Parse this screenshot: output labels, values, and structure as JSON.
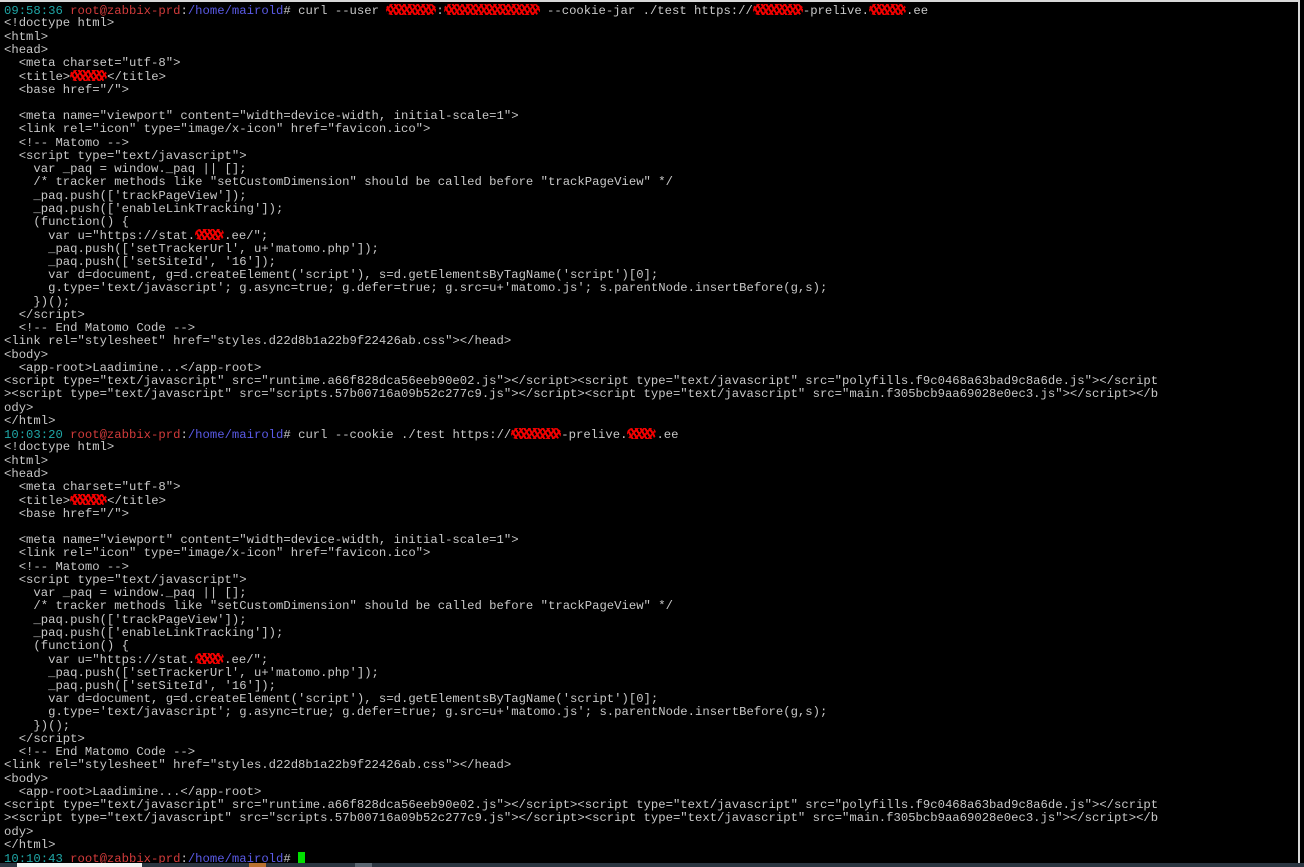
{
  "colors": {
    "time": "#1fa7a7",
    "user": "#d23b3b",
    "path": "#5a5ae6",
    "text": "#c8c8c8",
    "cursor": "#00e000",
    "redaction": "#ff0000"
  },
  "terminal": {
    "lines": [
      [
        {
          "c": "time",
          "t": "09:58:36 "
        },
        {
          "c": "user",
          "t": "root@zabbix-prd"
        },
        {
          "c": "sep",
          "t": ":"
        },
        {
          "c": "path",
          "t": "/home/mairold"
        },
        {
          "c": "sep",
          "t": "# curl --user "
        },
        {
          "redacted": "md"
        },
        {
          "t": ":"
        },
        {
          "redacted": "lg"
        },
        {
          "t": " --cookie-jar ./test https://"
        },
        {
          "redacted": "md"
        },
        {
          "t": "-prelive."
        },
        {
          "redacted": "sm"
        },
        {
          "t": ".ee"
        }
      ],
      "<!doctype html>",
      "<html>",
      "<head>",
      "  <meta charset=\"utf-8\">",
      [
        {
          "t": "  <title>"
        },
        {
          "redacted": "sm"
        },
        {
          "t": "</title>"
        }
      ],
      "  <base href=\"/\">",
      "",
      "  <meta name=\"viewport\" content=\"width=device-width, initial-scale=1\">",
      "  <link rel=\"icon\" type=\"image/x-icon\" href=\"favicon.ico\">",
      "  <!-- Matomo -->",
      "  <script type=\"text/javascript\">",
      "    var _paq = window._paq || [];",
      "    /* tracker methods like \"setCustomDimension\" should be called before \"trackPageView\" */",
      "    _paq.push(['trackPageView']);",
      "    _paq.push(['enableLinkTracking']);",
      "    (function() {",
      [
        {
          "t": "      var u=\"https://stat."
        },
        {
          "redacted": "xs"
        },
        {
          "t": ".ee/\";"
        }
      ],
      "      _paq.push(['setTrackerUrl', u+'matomo.php']);",
      "      _paq.push(['setSiteId', '16']);",
      "      var d=document, g=d.createElement('script'), s=d.getElementsByTagName('script')[0];",
      "      g.type='text/javascript'; g.async=true; g.defer=true; g.src=u+'matomo.js'; s.parentNode.insertBefore(g,s);",
      "    })();",
      "  </script>",
      "  <!-- End Matomo Code -->",
      "<link rel=\"stylesheet\" href=\"styles.d22d8b1a22b9f22426ab.css\"></head>",
      "<body>",
      "  <app-root>Laadimine...</app-root>",
      "<script type=\"text/javascript\" src=\"runtime.a66f828dca56eeb90e02.js\"></script><script type=\"text/javascript\" src=\"polyfills.f9c0468a63bad9c8a6de.js\"></script",
      "><script type=\"text/javascript\" src=\"scripts.57b00716a09b52c277c9.js\"></script><script type=\"text/javascript\" src=\"main.f305bcb9aa69028e0ec3.js\"></script></b",
      "ody>",
      "</html>",
      [
        {
          "c": "time",
          "t": "10:03:20 "
        },
        {
          "c": "user",
          "t": "root@zabbix-prd"
        },
        {
          "c": "sep",
          "t": ":"
        },
        {
          "c": "path",
          "t": "/home/mairold"
        },
        {
          "c": "sep",
          "t": "# curl --cookie ./test https://"
        },
        {
          "redacted": "md"
        },
        {
          "t": "-prelive."
        },
        {
          "redacted": "xs"
        },
        {
          "t": ".ee"
        }
      ],
      "<!doctype html>",
      "<html>",
      "<head>",
      "  <meta charset=\"utf-8\">",
      [
        {
          "t": "  <title>"
        },
        {
          "redacted": "sm"
        },
        {
          "t": "</title>"
        }
      ],
      "  <base href=\"/\">",
      "",
      "  <meta name=\"viewport\" content=\"width=device-width, initial-scale=1\">",
      "  <link rel=\"icon\" type=\"image/x-icon\" href=\"favicon.ico\">",
      "  <!-- Matomo -->",
      "  <script type=\"text/javascript\">",
      "    var _paq = window._paq || [];",
      "    /* tracker methods like \"setCustomDimension\" should be called before \"trackPageView\" */",
      "    _paq.push(['trackPageView']);",
      "    _paq.push(['enableLinkTracking']);",
      "    (function() {",
      [
        {
          "t": "      var u=\"https://stat."
        },
        {
          "redacted": "xs"
        },
        {
          "t": ".ee/\";"
        }
      ],
      "      _paq.push(['setTrackerUrl', u+'matomo.php']);",
      "      _paq.push(['setSiteId', '16']);",
      "      var d=document, g=d.createElement('script'), s=d.getElementsByTagName('script')[0];",
      "      g.type='text/javascript'; g.async=true; g.defer=true; g.src=u+'matomo.js'; s.parentNode.insertBefore(g,s);",
      "    })();",
      "  </script>",
      "  <!-- End Matomo Code -->",
      "<link rel=\"stylesheet\" href=\"styles.d22d8b1a22b9f22426ab.css\"></head>",
      "<body>",
      "  <app-root>Laadimine...</app-root>",
      "<script type=\"text/javascript\" src=\"runtime.a66f828dca56eeb90e02.js\"></script><script type=\"text/javascript\" src=\"polyfills.f9c0468a63bad9c8a6de.js\"></script",
      "><script type=\"text/javascript\" src=\"scripts.57b00716a09b52c277c9.js\"></script><script type=\"text/javascript\" src=\"main.f305bcb9aa69028e0ec3.js\"></script></b",
      "ody>",
      "</html>",
      [
        {
          "c": "time",
          "t": "10:10:43 "
        },
        {
          "c": "user",
          "t": "root@zabbix-prd"
        },
        {
          "c": "sep",
          "t": ":"
        },
        {
          "c": "path",
          "t": "/home/mairold"
        },
        {
          "c": "sep",
          "t": "# "
        },
        {
          "cursor": true
        }
      ]
    ]
  }
}
